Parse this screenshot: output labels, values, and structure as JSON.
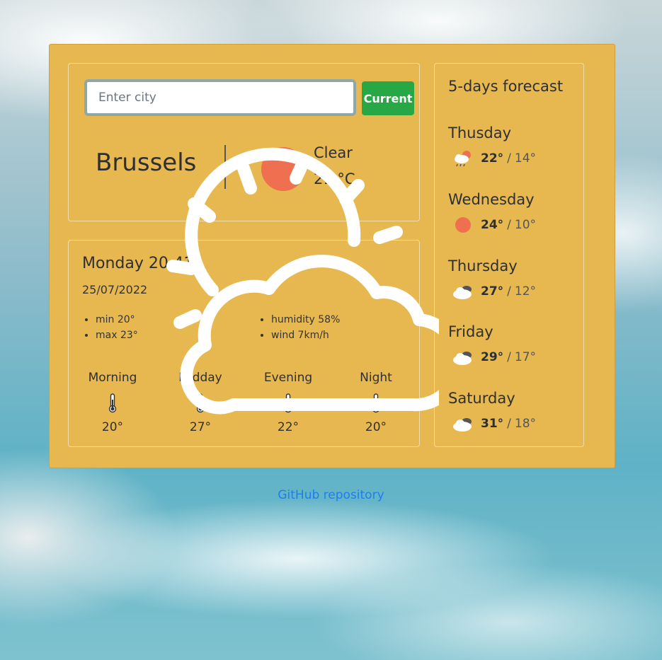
{
  "search": {
    "placeholder": "Enter city",
    "current_label": "Current"
  },
  "current": {
    "city": "Brussels",
    "condition": "Clear",
    "temperature": "21 °C",
    "icon": "sun-icon"
  },
  "details": {
    "day_time": "Monday 20:41",
    "date": "25/07/2022",
    "min": "min 20°",
    "max": "max 23°",
    "humidity": "humidity 58%",
    "wind": "wind 7km/h",
    "periods": [
      {
        "label": "Morning",
        "temp": "20°",
        "icon": "thermometer-icon"
      },
      {
        "label": "Midday",
        "temp": "27°",
        "icon": "thermometer-icon"
      },
      {
        "label": "Evening",
        "temp": "22°",
        "icon": "thermometer-icon"
      },
      {
        "label": "Night",
        "temp": "20°",
        "icon": "thermometer-icon"
      }
    ]
  },
  "forecast": {
    "title": "5-days forecast",
    "days": [
      {
        "day": "Thusday",
        "high": "22°",
        "low": "14°",
        "icon": "rain-sun-cloud-icon"
      },
      {
        "day": "Wednesday",
        "high": "24°",
        "low": "10°",
        "icon": "sun-icon"
      },
      {
        "day": "Thursday",
        "high": "27°",
        "low": "12°",
        "icon": "dark-cloud-icon"
      },
      {
        "day": "Friday",
        "high": "29°",
        "low": "17°",
        "icon": "dark-cloud-icon"
      },
      {
        "day": "Saturday",
        "high": "31°",
        "low": "18°",
        "icon": "dark-cloud-icon"
      }
    ]
  },
  "footer": {
    "link_text": "GitHub repository"
  },
  "colors": {
    "panel": "#e7b84f",
    "button": "#28a745",
    "sun": "#ee7050",
    "link": "#1f7ee8"
  }
}
